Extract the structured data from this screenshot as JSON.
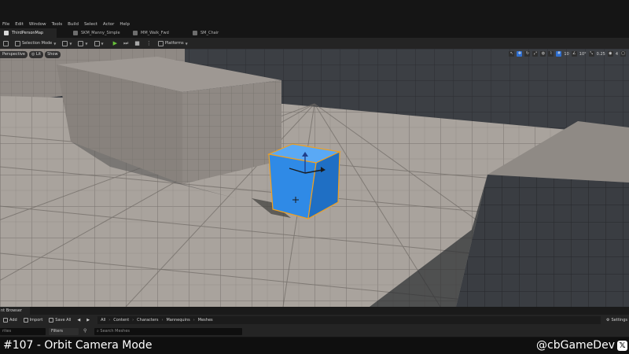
{
  "menu": [
    "File",
    "Edit",
    "Window",
    "Tools",
    "Build",
    "Select",
    "Actor",
    "Help"
  ],
  "tabs": [
    {
      "label": "ThirdPersonMap",
      "active": true
    },
    {
      "label": "SKM_Manny_Simple",
      "active": false
    },
    {
      "label": "MM_Walk_Fwd",
      "active": false
    },
    {
      "label": "SM_Chair",
      "active": false
    }
  ],
  "toolbar": {
    "selection_mode": "Selection Mode",
    "platforms": "Platforms"
  },
  "viewport_bar": {
    "perspective": "Perspective",
    "lit": "Lit",
    "show": "Show",
    "grid_snap": "10",
    "rotation_snap": "10°",
    "scale_snap": "0.25",
    "camera_speed": "4"
  },
  "content_browser": {
    "tab_label": "nt Browser",
    "add": "Add",
    "import": "Import",
    "save_all": "Save All",
    "breadcrumbs": [
      "All",
      "Content",
      "Characters",
      "Mannequins",
      "Meshes"
    ],
    "settings": "Settings",
    "folder_search": "rites",
    "filters": "Filters",
    "search_placeholder": "Search Meshes"
  },
  "caption": {
    "title": "#107 - Orbit Camera Mode",
    "handle": "@cbGameDev"
  },
  "colors": {
    "cube": "#2f8ae6",
    "selection": "#f0a020",
    "accent_blue": "#2f6fd0",
    "play_green": "#67c23a"
  }
}
